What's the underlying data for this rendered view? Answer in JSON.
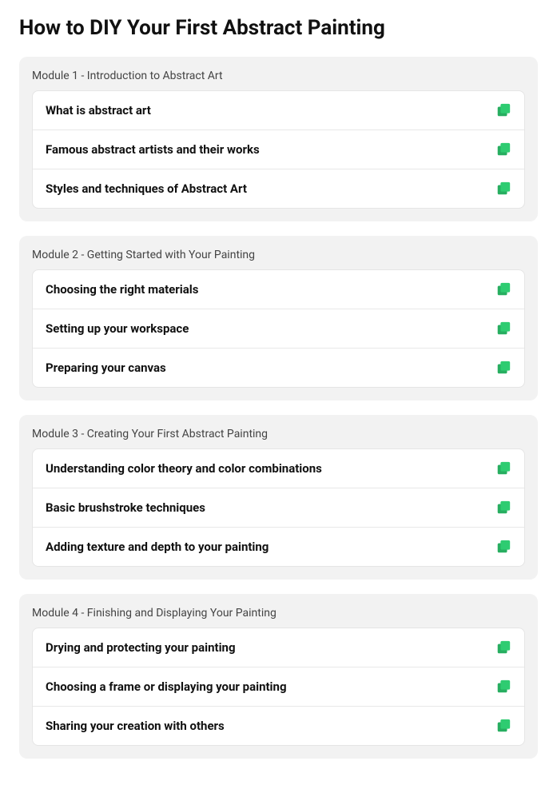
{
  "page": {
    "title": "How to DIY Your First Abstract Painting"
  },
  "modules": [
    {
      "id": "module-1",
      "title": "Module 1 - Introduction to Abstract Art",
      "lessons": [
        {
          "id": "lesson-1-1",
          "label": "What is abstract art"
        },
        {
          "id": "lesson-1-2",
          "label": "Famous abstract artists and their works"
        },
        {
          "id": "lesson-1-3",
          "label": "Styles and techniques of Abstract Art"
        }
      ]
    },
    {
      "id": "module-2",
      "title": "Module 2 - Getting Started with Your Painting",
      "lessons": [
        {
          "id": "lesson-2-1",
          "label": "Choosing the right materials"
        },
        {
          "id": "lesson-2-2",
          "label": "Setting up your workspace"
        },
        {
          "id": "lesson-2-3",
          "label": "Preparing your canvas"
        }
      ]
    },
    {
      "id": "module-3",
      "title": "Module 3 - Creating Your First Abstract Painting",
      "lessons": [
        {
          "id": "lesson-3-1",
          "label": "Understanding color theory and color combinations"
        },
        {
          "id": "lesson-3-2",
          "label": "Basic brushstroke techniques"
        },
        {
          "id": "lesson-3-3",
          "label": "Adding texture and depth to your painting"
        }
      ]
    },
    {
      "id": "module-4",
      "title": "Module 4 - Finishing and Displaying Your Painting",
      "lessons": [
        {
          "id": "lesson-4-1",
          "label": "Drying and protecting your painting"
        },
        {
          "id": "lesson-4-2",
          "label": "Choosing a frame or displaying your painting"
        },
        {
          "id": "lesson-4-3",
          "label": "Sharing your creation with others"
        }
      ]
    }
  ],
  "icons": {
    "copy": "copy-icon",
    "accent_color": "#2ecc71"
  }
}
